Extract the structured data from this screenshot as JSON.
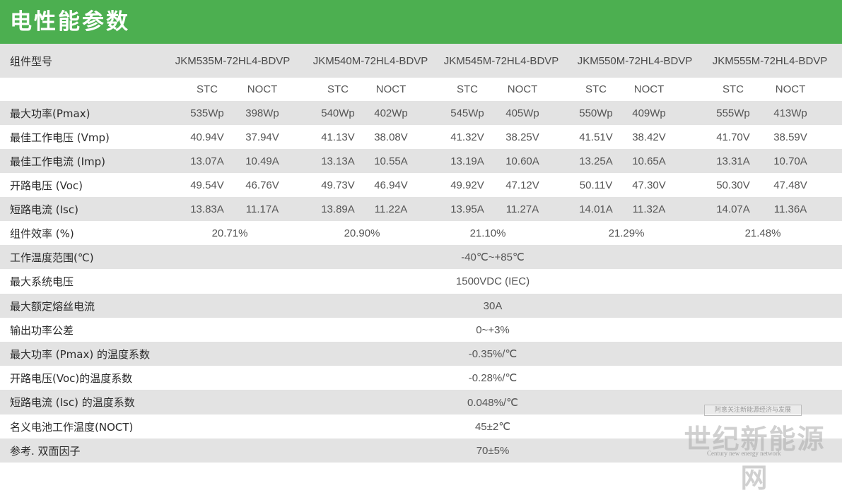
{
  "title": "电性能参数",
  "header_row": {
    "label": "组件型号",
    "models": [
      "JKM535M-72HL4-BDVP",
      "JKM540M-72HL4-BDVP",
      "JKM545M-72HL4-BDVP",
      "JKM550M-72HL4-BDVP",
      "JKM555M-72HL4-BDVP"
    ]
  },
  "condition_row": {
    "stc": "STC",
    "noct": "NOCT"
  },
  "spec_rows": [
    {
      "label": "最大功率(Pmax)",
      "values": [
        "535Wp",
        "398Wp",
        "540Wp",
        "402Wp",
        "545Wp",
        "405Wp",
        "550Wp",
        "409Wp",
        "555Wp",
        "413Wp"
      ]
    },
    {
      "label": "最佳工作电压 (Vmp)",
      "values": [
        "40.94V",
        "37.94V",
        "41.13V",
        "38.08V",
        "41.32V",
        "38.25V",
        "41.51V",
        "38.42V",
        "41.70V",
        "38.59V"
      ]
    },
    {
      "label": "最佳工作电流 (Imp)",
      "values": [
        "13.07A",
        "10.49A",
        "13.13A",
        "10.55A",
        "13.19A",
        "10.60A",
        "13.25A",
        "10.65A",
        "13.31A",
        "10.70A"
      ]
    },
    {
      "label": "开路电压 (Voc)",
      "values": [
        "49.54V",
        "46.76V",
        "49.73V",
        "46.94V",
        "49.92V",
        "47.12V",
        "50.11V",
        "47.30V",
        "50.30V",
        "47.48V"
      ]
    },
    {
      "label": "短路电流 (Isc)",
      "values": [
        "13.83A",
        "11.17A",
        "13.89A",
        "11.22A",
        "13.95A",
        "11.27A",
        "14.01A",
        "11.32A",
        "14.07A",
        "11.36A"
      ]
    }
  ],
  "efficiency_row": {
    "label": "组件效率 (%)",
    "values": [
      "20.71%",
      "20.90%",
      "21.10%",
      "21.29%",
      "21.48%"
    ]
  },
  "common_rows": [
    {
      "label": "工作温度范围(℃)",
      "value": "-40℃~+85℃"
    },
    {
      "label": "最大系统电压",
      "value": "1500VDC (IEC)"
    },
    {
      "label": "最大额定熔丝电流",
      "value": "30A"
    },
    {
      "label": "输出功率公差",
      "value": "0~+3%"
    },
    {
      "label": "最大功率 (Pmax) 的温度系数",
      "value": "-0.35%/℃"
    },
    {
      "label": "开路电压(Voc)的温度系数",
      "value": "-0.28%/℃"
    },
    {
      "label": "短路电流 (Isc) 的温度系数",
      "value": "0.048%/℃"
    },
    {
      "label": "名义电池工作温度(NOCT)",
      "value": "45±2℃"
    },
    {
      "label": "参考. 双面因子",
      "value": "70±5%"
    }
  ],
  "watermark": {
    "small": "阿意关注新能源经济与发展",
    "big": "世纪新能源网",
    "en": "Century new energy network"
  },
  "colors": {
    "header_bg": "#4caf50",
    "row_gray": "#e3e3e3",
    "text": "#555555"
  }
}
